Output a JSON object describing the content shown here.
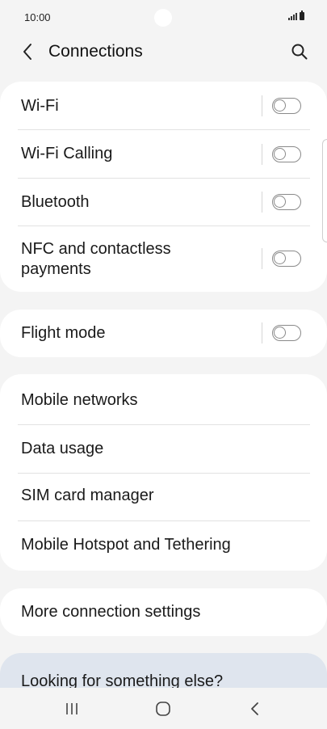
{
  "status_bar": {
    "time": "10:00"
  },
  "header": {
    "back_icon": "chevron-left-icon",
    "title": "Connections",
    "search_icon": "search-icon"
  },
  "toggle_group": [
    {
      "label": "Wi-Fi",
      "enabled": false
    },
    {
      "label": "Wi-Fi Calling",
      "enabled": false
    },
    {
      "label": "Bluetooth",
      "enabled": false
    },
    {
      "label_line1": "NFC and contactless",
      "label_line2": "payments",
      "enabled": false
    }
  ],
  "flight_mode": {
    "label": "Flight mode",
    "enabled": false
  },
  "network_group": [
    {
      "label": "Mobile networks"
    },
    {
      "label": "Data usage"
    },
    {
      "label": "SIM card manager"
    },
    {
      "label": "Mobile Hotspot and Tethering"
    }
  ],
  "more_settings": {
    "label": "More connection settings"
  },
  "looking": {
    "label": "Looking for something else?"
  },
  "nav": {
    "recents_icon": "recents-icon",
    "home_icon": "home-icon",
    "back_icon": "back-icon"
  },
  "colors": {
    "background": "#f4f4f4",
    "card": "#ffffff",
    "looking_card": "#dfe5ee"
  }
}
